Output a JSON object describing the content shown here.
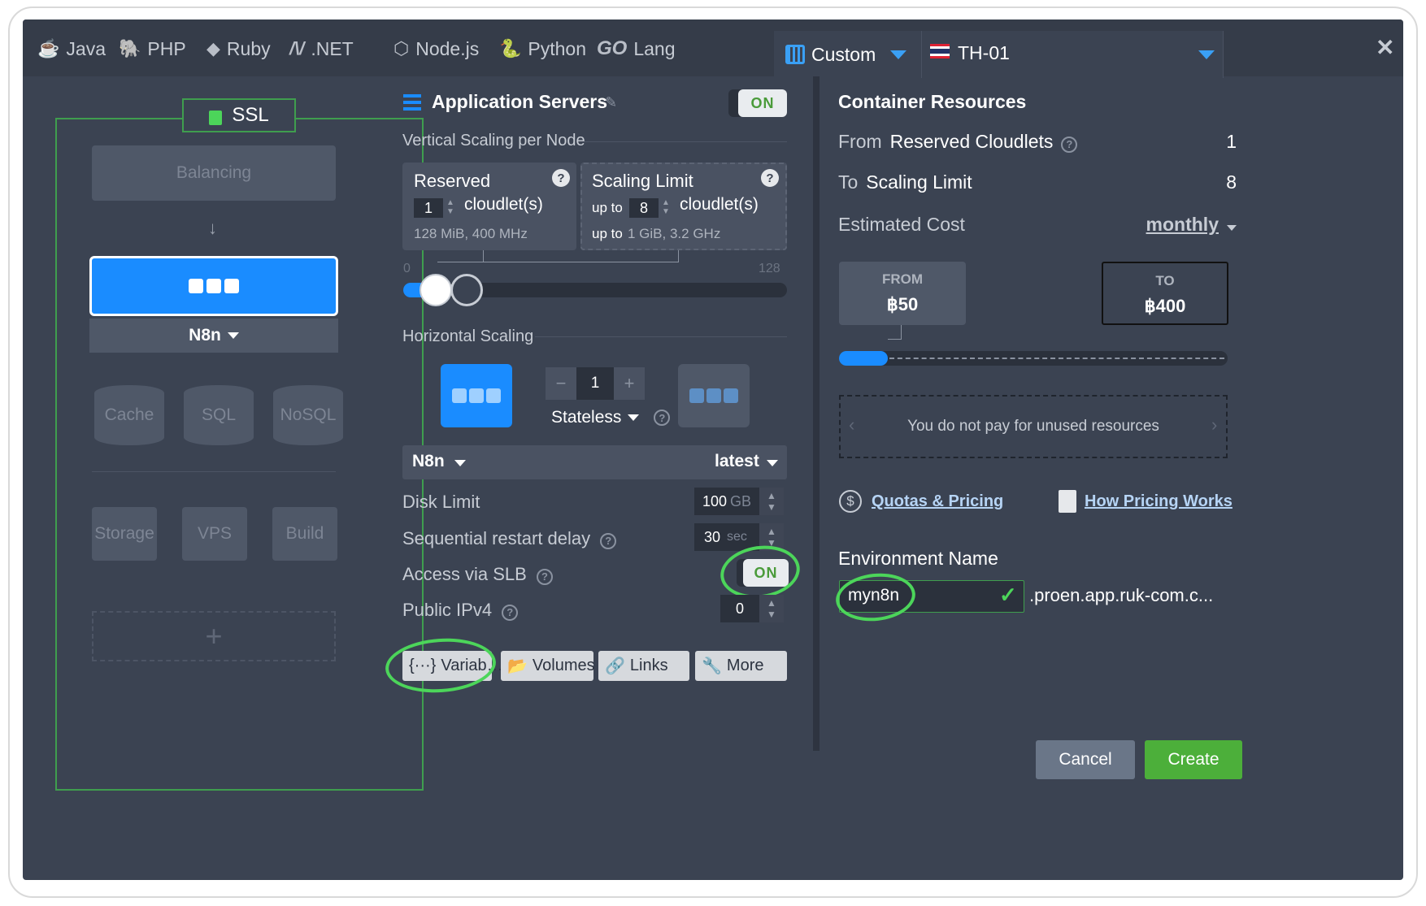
{
  "tabs": [
    {
      "label": "Java",
      "icon": "java-icon"
    },
    {
      "label": "PHP",
      "icon": "php-icon"
    },
    {
      "label": "Ruby",
      "icon": "ruby-icon"
    },
    {
      "label": ".NET",
      "icon": "dotnet-icon"
    },
    {
      "label": "Node.js",
      "icon": "nodejs-icon"
    },
    {
      "label": "Python",
      "icon": "python-icon"
    },
    {
      "label": "Lang",
      "icon": "go-icon",
      "glyph": "GO"
    },
    {
      "label": "Custom",
      "icon": "custom-icon",
      "active": true
    }
  ],
  "region": {
    "label": "TH-01",
    "icon": "thai-flag-icon"
  },
  "topology": {
    "ssl": "SSL",
    "balancing": "Balancing",
    "node_name": "N8n",
    "cache": "Cache",
    "sql": "SQL",
    "nosql": "NoSQL",
    "storage": "Storage",
    "vps": "VPS",
    "build": "Build",
    "add": "+"
  },
  "app_servers": {
    "title": "Application Servers",
    "toggle": "ON",
    "vertical_title": "Vertical Scaling per Node",
    "reserved": {
      "label": "Reserved",
      "value": "1",
      "unit": "cloudlet(s)",
      "specs": "128 MiB, 400 MHz"
    },
    "scaling_limit": {
      "label": "Scaling Limit",
      "prefix": "up to",
      "value": "8",
      "unit": "cloudlet(s)",
      "specs_prefix": "up to",
      "specs": "1 GiB, 3.2 GHz"
    },
    "slider_min": "0",
    "slider_max": "128",
    "horizontal_title": "Horizontal Scaling",
    "node_count": "1",
    "minus": "−",
    "plus": "+",
    "mode": "Stateless",
    "stack": "N8n",
    "tag": "latest",
    "disk_limit": {
      "label": "Disk Limit",
      "value": "100",
      "unit": "GB"
    },
    "restart_delay": {
      "label": "Sequential restart delay",
      "value": "30",
      "unit": "sec"
    },
    "slb": {
      "label": "Access via SLB",
      "value": "ON"
    },
    "ipv4": {
      "label": "Public IPv4",
      "value": "0"
    },
    "buttons": {
      "variables": "Variab…",
      "volumes": "Volumes",
      "links": "Links",
      "more": "More"
    }
  },
  "resources": {
    "title": "Container Resources",
    "from_prefix": "From",
    "from_label": "Reserved Cloudlets",
    "from_value": "1",
    "to_prefix": "To",
    "to_label": "Scaling Limit",
    "to_value": "8",
    "cost_label": "Estimated Cost",
    "period": "monthly",
    "from_card": {
      "label": "FROM",
      "price": "฿50"
    },
    "to_card": {
      "label": "TO",
      "price": "฿400"
    },
    "note": "You do not pay for unused resources",
    "quotas_link": "Quotas & Pricing",
    "how_link": "How Pricing Works"
  },
  "environment": {
    "label": "Environment Name",
    "value": "myn8n",
    "domain": ".proen.app.ruk-com.c..."
  },
  "footer": {
    "cancel": "Cancel",
    "create": "Create"
  },
  "colors": {
    "accent_blue": "#1a8cff",
    "on_green": "#4a9b3a",
    "create_green": "#4caf3a",
    "annotation_green": "#4cd55a"
  }
}
